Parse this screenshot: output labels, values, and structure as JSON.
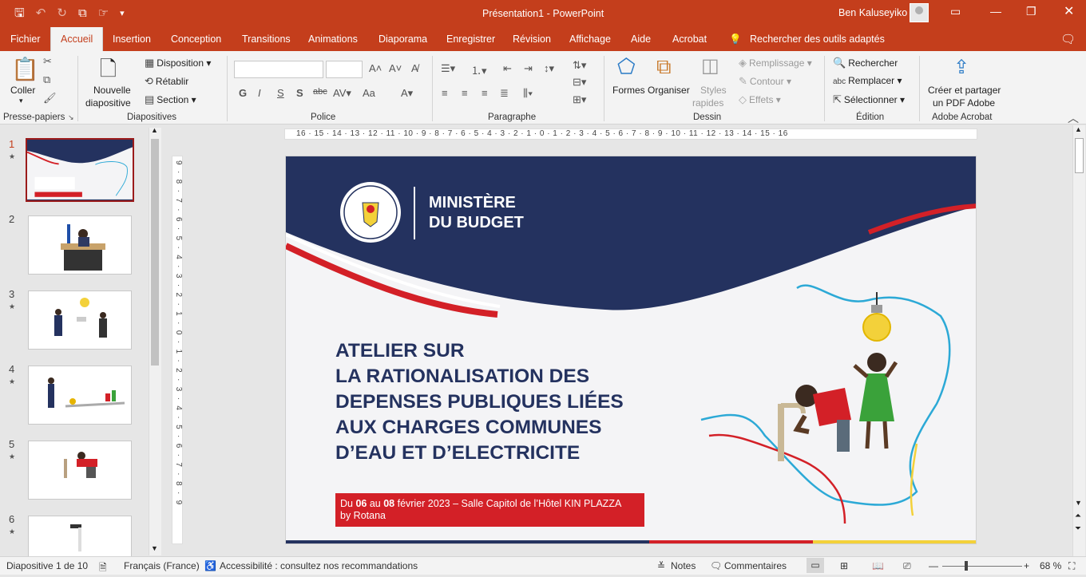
{
  "titlebar": {
    "doc_title": "Présentation1 - PowerPoint",
    "user_name": "Ben Kaluseyiko"
  },
  "tabs": [
    "Fichier",
    "Accueil",
    "Insertion",
    "Conception",
    "Transitions",
    "Animations",
    "Diaporama",
    "Enregistrer",
    "Révision",
    "Affichage",
    "Aide",
    "Acrobat"
  ],
  "active_tab": "Accueil",
  "tell_me": "Rechercher des outils adaptés",
  "ribbon": {
    "clipboard": {
      "paste": "Coller",
      "group": "Presse-papiers"
    },
    "slides": {
      "new_slide_1": "Nouvelle",
      "new_slide_2": "diapositive",
      "layout": "Disposition",
      "reset": "Rétablir",
      "section": "Section",
      "group": "Diapositives"
    },
    "font": {
      "group": "Police",
      "bold": "G",
      "italic": "I",
      "underline": "S",
      "shadow": "S",
      "strike": "abc",
      "case": "Aa"
    },
    "paragraph": {
      "group": "Paragraphe"
    },
    "drawing": {
      "shapes": "Formes",
      "arrange": "Organiser",
      "styles_1": "Styles",
      "styles_2": "rapides",
      "fill": "Remplissage",
      "outline": "Contour",
      "effects": "Effets",
      "group": "Dessin"
    },
    "editing": {
      "find": "Rechercher",
      "replace": "Remplacer",
      "select": "Sélectionner",
      "group": "Édition"
    },
    "acrobat": {
      "create_1": "Créer et partager",
      "create_2": "un PDF Adobe",
      "group": "Adobe Acrobat"
    }
  },
  "thumbnails": [
    {
      "num": "1",
      "star": "★"
    },
    {
      "num": "2",
      "star": ""
    },
    {
      "num": "3",
      "star": "★"
    },
    {
      "num": "4",
      "star": "★"
    },
    {
      "num": "5",
      "star": "★"
    },
    {
      "num": "6",
      "star": "★"
    }
  ],
  "ruler_h": "16 · 15 · 14 · 13 · 12 · 11 · 10 · 9 · 8 · 7 · 6 · 5 · 4 · 3 · 2 · 1 · 0 · 1 · 2 · 3 · 4 · 5 · 6 · 7 · 8 · 9 · 10 · 11 · 12 · 13 · 14 · 15 · 16",
  "ruler_v": "9 · 8 · 7 · 6 · 5 · 4 · 3 · 2 · 1 · 0 · 1 · 2 · 3 · 4 · 5 · 6 · 7 · 8 · 9",
  "slide": {
    "ministry_1": "MINISTÈRE",
    "ministry_2": "DU BUDGET",
    "seal_top": "RÉPUBLIQUE DÉMOCRATIQUE DU CONGO",
    "seal_bottom": "LE GOUVERNEMENT",
    "title_lines": [
      "ATELIER SUR",
      "LA RATIONALISATION DES",
      "DEPENSES PUBLIQUES LIÉES",
      "AUX CHARGES COMMUNES",
      "D’EAU ET D’ELECTRICITE"
    ],
    "banner_1a": "Du ",
    "banner_1b": "06",
    "banner_1c": " au ",
    "banner_1d": "08",
    "banner_1e": " février 2023 – Salle Capitol de l’Hôtel KIN PLAZZA",
    "banner_2": "by Rotana",
    "colors": {
      "navy": "#24325f",
      "red": "#d32027",
      "yellow": "#f3d13a",
      "cyan": "#2ca9d6"
    }
  },
  "status": {
    "slide_pos": "Diapositive 1 de 10",
    "language": "Français (France)",
    "accessibility": "Accessibilité : consultez nos recommandations",
    "notes": "Notes",
    "comments": "Commentaires",
    "zoom": "68 %"
  }
}
